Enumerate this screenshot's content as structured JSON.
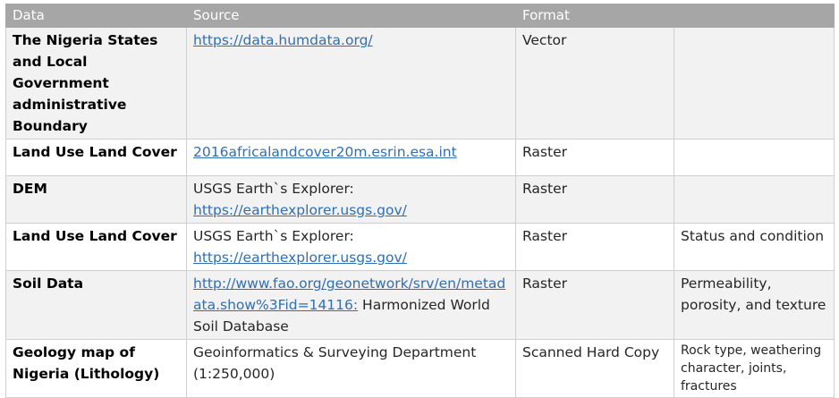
{
  "table": {
    "headers": [
      "Data",
      "Source",
      "Format",
      ""
    ],
    "rows": [
      {
        "data": "The Nigeria States and Local Government administrative Boundary",
        "source_link": "https://data.humdata.org/",
        "source_text": "",
        "format": "Vector",
        "notes": ""
      },
      {
        "data": "Land Use Land Cover",
        "source_link": "2016africalandcover20m.esrin.esa.int",
        "source_text": "",
        "format": "Raster",
        "notes": ""
      },
      {
        "data": "DEM",
        "source_text": "USGS Earth`s Explorer:",
        "source_link": "https://earthexplorer.usgs.gov/",
        "format": "Raster",
        "notes": ""
      },
      {
        "data": "Land Use Land Cover",
        "source_text": "USGS Earth`s Explorer:",
        "source_link": "https://earthexplorer.usgs.gov/",
        "format": "Raster",
        "notes": "Status and condition"
      },
      {
        "data": "Soil Data",
        "source_link": "http://www.fao.org/geonetwork/srv/en/metadata.show%3Fid=14116:",
        "source_text": "Harmonized World Soil Database",
        "format": "Raster",
        "notes": "Permeability, porosity, and texture"
      },
      {
        "data": "Geology map of Nigeria (Lithology)",
        "source_text": "Geoinformatics & Surveying Department (1:250,000)",
        "source_link": "",
        "format": "Scanned Hard Copy",
        "notes": "Rock type, weathering character, joints, fractures"
      }
    ]
  }
}
